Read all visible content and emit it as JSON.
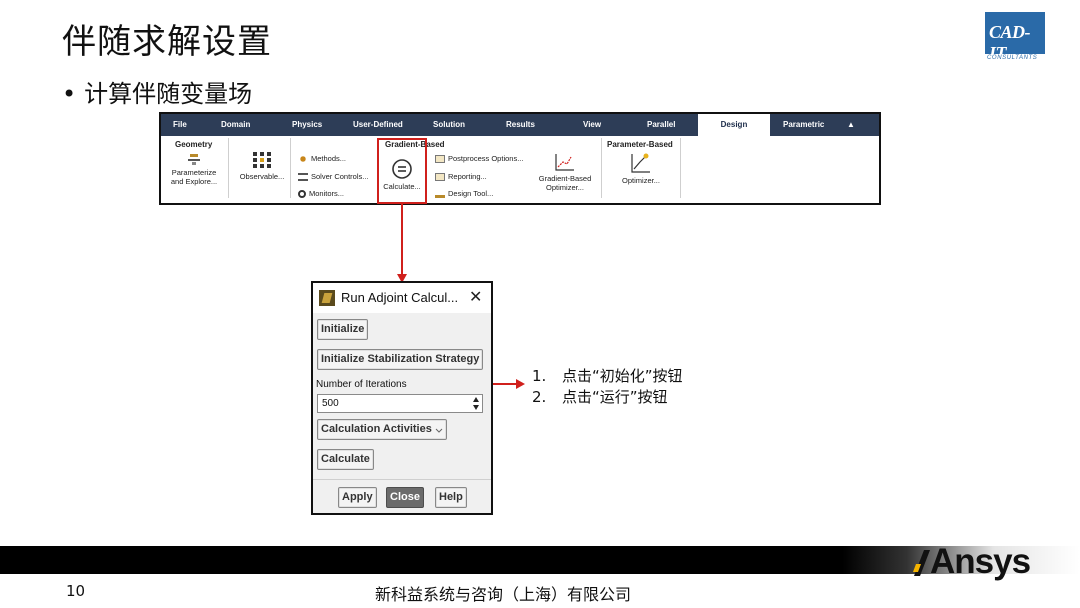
{
  "slide": {
    "title": "伴随求解设置",
    "bullet": "计算伴随变量场",
    "bullet_marker": "•",
    "page_number": "10",
    "footer_text": "新科益系统与咨询（上海）有限公司"
  },
  "logos": {
    "cad_main": "CAD-IT",
    "cad_sub": "CONSULTANTS",
    "ansys": "Ansys"
  },
  "ribbon": {
    "tabs": [
      "File",
      "Domain",
      "Physics",
      "User-Defined",
      "Solution",
      "Results",
      "View",
      "Parallel",
      "Design",
      "Parametric",
      "▲"
    ],
    "active_tab": "Design",
    "groups": {
      "geometry": {
        "title": "Geometry",
        "parameterize": "Parameterize\nand Explore..."
      },
      "observable": "Observable...",
      "gradient": {
        "title": "Gradient-Based",
        "methods": "Methods...",
        "solver_controls": "Solver Controls...",
        "monitors": "Monitors...",
        "calculate": "Calculate...",
        "postprocess_options": "Postprocess Options...",
        "reporting": "Reporting...",
        "design_tool": "Design Tool...",
        "optimizer": "Gradient-Based\nOptimizer..."
      },
      "parameter": {
        "title": "Parameter-Based",
        "optimizer": "Optimizer..."
      }
    }
  },
  "dialog": {
    "title": "Run Adjoint Calcul...",
    "close_glyph": "✕",
    "initialize": "Initialize",
    "init_stabilization": "Initialize Stabilization Strategy",
    "iterations_label": "Number of Iterations",
    "iterations_value": "500",
    "calc_activities": "Calculation Activities",
    "calculate": "Calculate",
    "apply": "Apply",
    "close": "Close",
    "help": "Help"
  },
  "steps": [
    {
      "num": "1.",
      "text": "点击“初始化”按钮"
    },
    {
      "num": "2.",
      "text": "点击“运行”按钮"
    }
  ],
  "colors": {
    "tabbar": "#2d3d57",
    "highlight": "#d0201c",
    "cad_blue": "#2a6aa8"
  }
}
